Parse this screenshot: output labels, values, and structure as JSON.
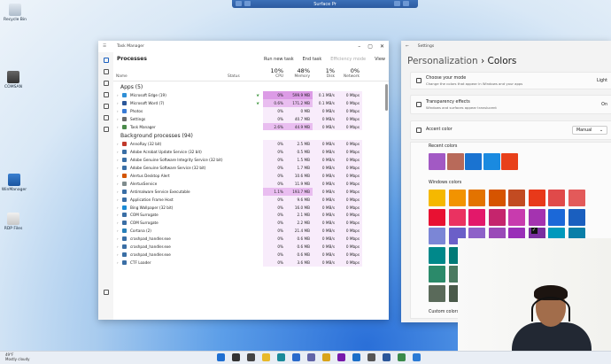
{
  "rdp_bar": {
    "title": "Surface Pr"
  },
  "desktop_icons": [
    {
      "label": "Recycle Bin"
    },
    {
      "label": "COMSAN"
    },
    {
      "label": "WinManager"
    },
    {
      "label": "RDP Files"
    }
  ],
  "task_manager": {
    "title": "Task Manager",
    "page_title": "Processes",
    "toolbar": {
      "run_new_task": "Run new task",
      "end_task": "End task",
      "efficiency_mode": "Efficiency mode",
      "view": "View"
    },
    "columns": {
      "name": "Name",
      "status": "Status",
      "cpu_pct": "10%",
      "cpu": "CPU",
      "memory_pct": "48%",
      "memory": "Memory",
      "disk_pct": "1%",
      "disk": "Disk",
      "network_pct": "0%",
      "network": "Network"
    },
    "apps_header": "Apps (5)",
    "apps": [
      {
        "name": "Microsoft Edge (19)",
        "cpu": "0%",
        "memory": "599.9 MB",
        "disk": "0.1 MB/s",
        "network": "0 Mbps",
        "icon_color": "#2f8fd6",
        "heat": 3,
        "status_icon": true
      },
      {
        "name": "Microsoft Word (7)",
        "cpu": "0.6%",
        "memory": "171.2 MB",
        "disk": "0.1 MB/s",
        "network": "0 Mbps",
        "icon_color": "#2b579a",
        "heat": 2,
        "status_icon": true
      },
      {
        "name": "Photos",
        "cpu": "0%",
        "memory": "0 MB",
        "disk": "0 MB/s",
        "network": "0 Mbps",
        "icon_color": "#3a7bd5",
        "heat": 1,
        "status_icon": false
      },
      {
        "name": "Settings",
        "cpu": "0%",
        "memory": "40.7 MB",
        "disk": "0 MB/s",
        "network": "0 Mbps",
        "icon_color": "#6b6b6b",
        "heat": 1,
        "status_icon": false
      },
      {
        "name": "Task Manager",
        "cpu": "2.6%",
        "memory": "44.9 MB",
        "disk": "0 MB/s",
        "network": "0 Mbps",
        "icon_color": "#4a8a4a",
        "heat": 2,
        "status_icon": false
      }
    ],
    "background_header": "Background processes (94)",
    "background": [
      {
        "name": "AnnoRay (32 bit)",
        "cpu": "0%",
        "memory": "2.5 MB",
        "disk": "0 MB/s",
        "network": "0 Mbps",
        "icon_color": "#c0392b"
      },
      {
        "name": "Adobe Acrobat Update Service (32 bit)",
        "cpu": "0%",
        "memory": "0.5 MB",
        "disk": "0 MB/s",
        "network": "0 Mbps",
        "icon_color": "#3a6ea5"
      },
      {
        "name": "Adobe Genuine Software Integrity Service (32 bit)",
        "cpu": "0%",
        "memory": "1.5 MB",
        "disk": "0 MB/s",
        "network": "0 Mbps",
        "icon_color": "#3a6ea5"
      },
      {
        "name": "Adobe Genuine Software Service (32 bit)",
        "cpu": "0%",
        "memory": "1.7 MB",
        "disk": "0 MB/s",
        "network": "0 Mbps",
        "icon_color": "#3a6ea5"
      },
      {
        "name": "Alertus Desktop Alert",
        "cpu": "0%",
        "memory": "10.6 MB",
        "disk": "0 MB/s",
        "network": "0 Mbps",
        "icon_color": "#d35400"
      },
      {
        "name": "AlertusService",
        "cpu": "0%",
        "memory": "11.9 MB",
        "disk": "0 MB/s",
        "network": "0 Mbps",
        "icon_color": "#7f8c8d"
      },
      {
        "name": "Antimalware Service Executable",
        "cpu": "1.1%",
        "memory": "193.7 MB",
        "disk": "0 MB/s",
        "network": "0 Mbps",
        "icon_color": "#3a6ea5",
        "highlight": true
      },
      {
        "name": "Application Frame Host",
        "cpu": "0%",
        "memory": "9.6 MB",
        "disk": "0 MB/s",
        "network": "0 Mbps",
        "icon_color": "#3a6ea5"
      },
      {
        "name": "Bing Wallpaper (32 bit)",
        "cpu": "0%",
        "memory": "16.0 MB",
        "disk": "0 MB/s",
        "network": "0 Mbps",
        "icon_color": "#1a8ad4"
      },
      {
        "name": "COM Surrogate",
        "cpu": "0%",
        "memory": "2.1 MB",
        "disk": "0 MB/s",
        "network": "0 Mbps",
        "icon_color": "#3a6ea5"
      },
      {
        "name": "COM Surrogate",
        "cpu": "0%",
        "memory": "2.2 MB",
        "disk": "0 MB/s",
        "network": "0 Mbps",
        "icon_color": "#3a6ea5"
      },
      {
        "name": "Cortana (2)",
        "cpu": "0%",
        "memory": "21.4 MB",
        "disk": "0 MB/s",
        "network": "0 Mbps",
        "icon_color": "#2980b9"
      },
      {
        "name": "crashpad_handler.exe",
        "cpu": "0%",
        "memory": "0.6 MB",
        "disk": "0 MB/s",
        "network": "0 Mbps",
        "icon_color": "#3a6ea5"
      },
      {
        "name": "crashpad_handler.exe",
        "cpu": "0%",
        "memory": "0.6 MB",
        "disk": "0 MB/s",
        "network": "0 Mbps",
        "icon_color": "#3a6ea5"
      },
      {
        "name": "crashpad_handler.exe",
        "cpu": "0%",
        "memory": "0.6 MB",
        "disk": "0 MB/s",
        "network": "0 Mbps",
        "icon_color": "#3a6ea5"
      },
      {
        "name": "CTF Loader",
        "cpu": "0%",
        "memory": "3.6 MB",
        "disk": "0 MB/s",
        "network": "0 Mbps",
        "icon_color": "#3a6ea5"
      }
    ]
  },
  "settings": {
    "title": "Settings",
    "breadcrumb_parent": "Personalization",
    "breadcrumb_sep": "›",
    "breadcrumb_current": "Colors",
    "mode": {
      "label": "Choose your mode",
      "desc": "Change the colors that appear in Windows and your apps",
      "value": "Light"
    },
    "transparency": {
      "label": "Transparency effects",
      "desc": "Windows and surfaces appear translucent",
      "value": "On"
    },
    "accent": {
      "label": "Accent color",
      "value": "Manual"
    },
    "recent_colors_label": "Recent colors",
    "recent_colors": [
      "#a259c4",
      "#b86a5a",
      "#1a73d1",
      "#1a8ae0",
      "#e8401a"
    ],
    "windows_colors_label": "Windows colors",
    "windows_colors": [
      [
        "#f5b800",
        "#f29300",
        "#e37300",
        "#d65400",
        "#c24b22",
        "#e8391a",
        "#e04a4a",
        "#e35a5a"
      ],
      [
        "#e81132",
        "#ea3261",
        "#e3186a",
        "#c5256d",
        "#c83bae",
        "#a433b0",
        "#1b68d8",
        "#1a5fbf"
      ],
      [
        "#7b86d6",
        "#6b5fc8",
        "#8e62c8",
        "#9a4bb8",
        "#9a2fb8",
        "#7a2fa0",
        "#0099bc",
        "#0a7fa8"
      ],
      [
        "#00888a",
        "#007a77",
        "",
        "",
        "",
        "",
        "",
        ""
      ],
      [
        "#2b8a6a",
        "#4a7a60",
        "",
        "",
        "",
        "",
        "",
        ""
      ],
      [
        "#5a6a5a",
        "#4a5a4a",
        "",
        "",
        "",
        "",
        "",
        ""
      ]
    ],
    "selected_color": {
      "row": 2,
      "col": 5
    },
    "custom_colors_label": "Custom colors"
  },
  "taskbar": {
    "weather_temp": "49°F",
    "weather_desc": "Mostly cloudy",
    "apps": [
      {
        "name": "start-icon",
        "color": "#1f6fd1"
      },
      {
        "name": "search-icon",
        "color": "#333333"
      },
      {
        "name": "task-view-icon",
        "color": "#444444"
      },
      {
        "name": "file-explorer-icon",
        "color": "#e8b92a"
      },
      {
        "name": "edge-icon",
        "color": "#1a8a9a"
      },
      {
        "name": "store-icon",
        "color": "#2a6acb"
      },
      {
        "name": "teams-icon",
        "color": "#6264a7"
      },
      {
        "name": "chrome-icon",
        "color": "#d9a41a"
      },
      {
        "name": "onenote-icon",
        "color": "#7719aa"
      },
      {
        "name": "outlook-icon",
        "color": "#1a6ec8"
      },
      {
        "name": "settings-icon",
        "color": "#555555"
      },
      {
        "name": "word-icon",
        "color": "#2b579a"
      },
      {
        "name": "task-manager-icon",
        "color": "#3a8a4a"
      },
      {
        "name": "photos-icon",
        "color": "#2a7ad5"
      }
    ]
  }
}
